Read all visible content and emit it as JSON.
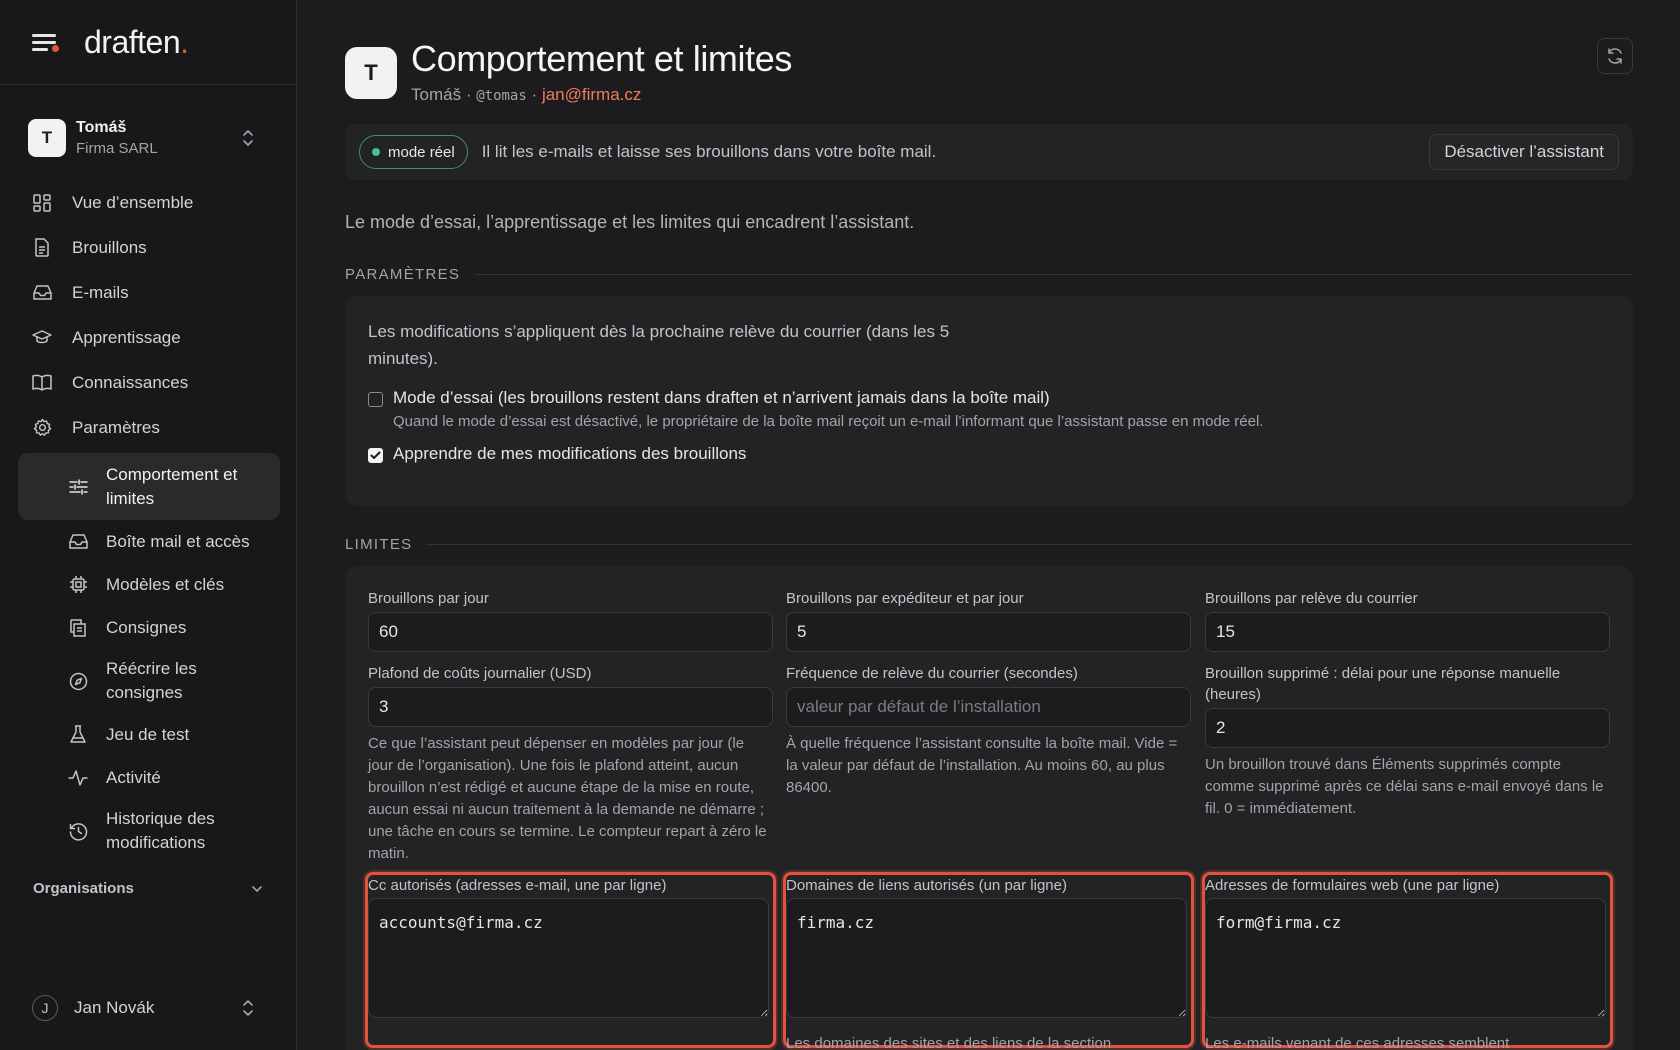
{
  "brand": {
    "name": "draften",
    "dot": "."
  },
  "account": {
    "initial": "T",
    "name": "Tomáš",
    "org": "Firma SARL"
  },
  "nav": {
    "items": [
      {
        "label": "Vue d’ensemble",
        "icon": "dashboard-icon"
      },
      {
        "label": "Brouillons",
        "icon": "document-icon"
      },
      {
        "label": "E-mails",
        "icon": "inbox-icon"
      },
      {
        "label": "Apprentissage",
        "icon": "graduation-cap-icon"
      },
      {
        "label": "Connaissances",
        "icon": "book-icon"
      },
      {
        "label": "Paramètres",
        "icon": "gear-icon"
      }
    ],
    "sub": [
      {
        "label": "Comportement et limites",
        "icon": "sliders-icon"
      },
      {
        "label": "Boîte mail et accès",
        "icon": "inbox-icon"
      },
      {
        "label": "Modèles et clés",
        "icon": "chip-icon"
      },
      {
        "label": "Consignes",
        "icon": "list-icon"
      },
      {
        "label": "Réécrire les consignes",
        "icon": "compass-icon"
      },
      {
        "label": "Jeu de test",
        "icon": "flask-icon"
      },
      {
        "label": "Activité",
        "icon": "activity-icon"
      },
      {
        "label": "Historique des modifications",
        "icon": "history-icon"
      }
    ]
  },
  "orgs_label": "Organisations",
  "user": {
    "initial": "J",
    "name": "Jan Novák"
  },
  "header": {
    "initial": "T",
    "title": "Comportement et limites",
    "name": "Tomáš",
    "sep": "·",
    "handle": "@tomas",
    "email": "jan@firma.cz"
  },
  "status": {
    "pill": "mode réel",
    "text": "Il lit les e-mails et laisse ses brouillons dans votre boîte mail.",
    "button": "Désactiver l’assistant",
    "pill_color": "#3fc28a"
  },
  "intro": "Le mode d’essai, l’apprentissage et les limites qui encadrent l’assistant.",
  "params": {
    "heading": "PARAMÈTRES",
    "note": "Les modifications s’appliquent dès la prochaine relève du courrier (dans les 5 minutes).",
    "trial_label": "Mode d’essai (les brouillons restent dans draften et n’arrivent jamais dans la boîte mail)",
    "trial_help": "Quand le mode d’essai est désactivé, le propriétaire de la boîte mail reçoit un e-mail l’informant que l’assistant passe en mode réel.",
    "trial_checked": false,
    "learn_label": "Apprendre de mes modifications des brouillons",
    "learn_checked": true
  },
  "limits": {
    "heading": "LIMITES",
    "per_day": {
      "label": "Brouillons par jour",
      "value": "60"
    },
    "per_sender": {
      "label": "Brouillons par expéditeur et par jour",
      "value": "5"
    },
    "per_fetch": {
      "label": "Brouillons par relève du courrier",
      "value": "15"
    },
    "cost_cap": {
      "label": "Plafond de coûts journalier (USD)",
      "value": "3",
      "help": "Ce que l’assistant peut dépenser en modèles par jour (le jour de l’organisation). Une fois le plafond atteint, aucun brouillon n’est rédigé et aucune étape de la mise en route, aucun essai ni aucun traitement à la demande ne démarre ; une tâche en cours se termine. Le compteur repart à zéro le matin."
    },
    "fetch_freq": {
      "label": "Fréquence de relève du courrier (secondes)",
      "value": "",
      "placeholder": "valeur par défaut de l’installation",
      "help": "À quelle fréquence l’assistant consulte la boîte mail. Vide = la valeur par défaut de l’installation. Au moins 60, au plus 86400."
    },
    "deleted_delay": {
      "label": "Brouillon supprimé : délai pour une réponse manuelle (heures)",
      "value": "2",
      "help": "Un brouillon trouvé dans Éléments supprimés compte comme supprimé après ce délai sans e-mail envoyé dans le fil. 0 = immédiatement."
    },
    "cc_allowed": {
      "label": "Cc autorisés (adresses e-mail, une par ligne)",
      "value": "accounts@firma.cz"
    },
    "link_domains": {
      "label": "Domaines de liens autorisés (un par ligne)",
      "value": "firma.cz",
      "help": "Les domaines des sites et des liens de la section"
    },
    "web_forms": {
      "label": "Adresses de formulaires web (une par ligne)",
      "value": "form@firma.cz",
      "help": "Les e-mails venant de ces adresses semblent"
    }
  },
  "colors": {
    "accent": "#e5533d",
    "highlight": "#e0533f",
    "bg": "#1c1c1e",
    "card": "#232326"
  }
}
